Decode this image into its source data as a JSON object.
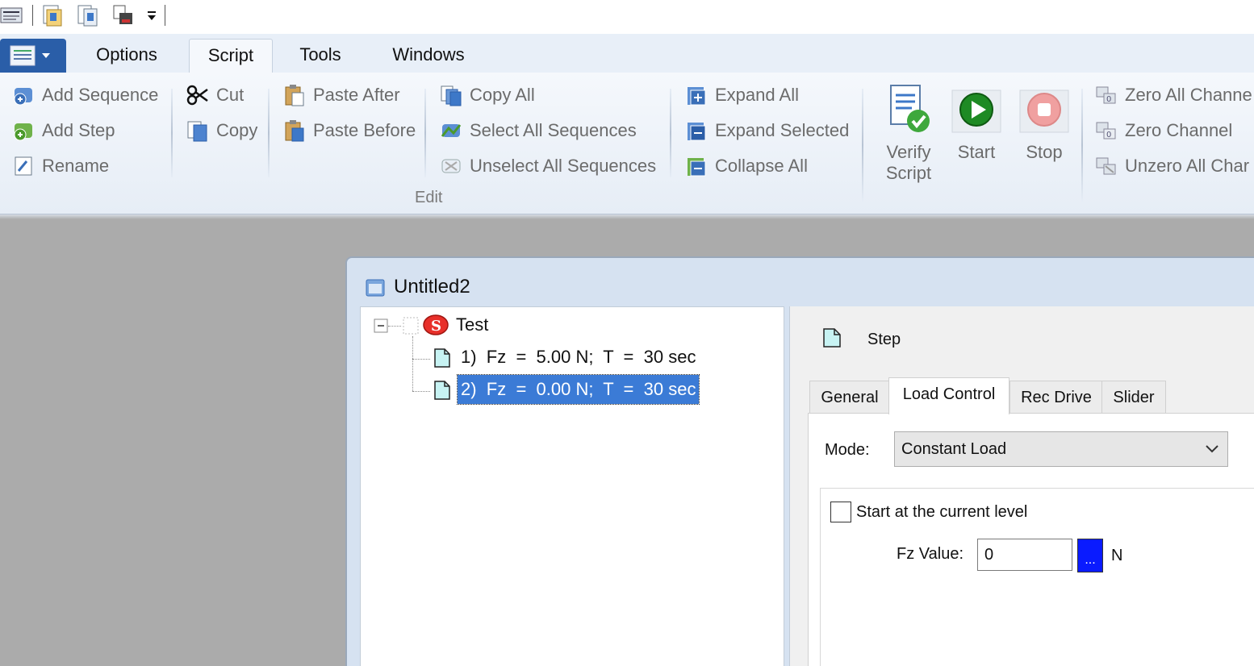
{
  "quick_access": {
    "icons": [
      "app-logo-icon",
      "open-script-icon",
      "save-script-icon",
      "print-icon",
      "customize-dropdown-icon"
    ]
  },
  "tabs": [
    {
      "label": "Options",
      "active": false
    },
    {
      "label": "Script",
      "active": true
    },
    {
      "label": "Tools",
      "active": false
    },
    {
      "label": "Windows",
      "active": false
    }
  ],
  "ribbon": {
    "add_sequence": "Add Sequence",
    "add_step": "Add Step",
    "rename": "Rename",
    "cut": "Cut",
    "copy": "Copy",
    "paste_after": "Paste After",
    "paste_before": "Paste Before",
    "copy_all": "Copy All",
    "select_all_sequences": "Select All Sequences",
    "unselect_all_sequences": "Unselect All Sequences",
    "expand_all": "Expand All",
    "expand_selected": "Expand Selected",
    "collapse_all": "Collapse All",
    "group_edit": "Edit",
    "verify_line1": "Verify",
    "verify_line2": "Script",
    "start": "Start",
    "stop": "Stop",
    "zero_all_channels": "Zero All Channe",
    "zero_channel": "Zero Channel",
    "unzero_all_channels": "Unzero All Char"
  },
  "document": {
    "title": "Untitled2",
    "tree": {
      "root": "Test",
      "items": [
        {
          "index": "1)",
          "text": "Fz  =  5.00 N;  T  =  30 sec",
          "selected": false
        },
        {
          "index": "2)",
          "text": "Fz  =  0.00 N;  T  =  30 sec",
          "selected": true
        }
      ]
    },
    "properties": {
      "header": "Step",
      "tabs": [
        {
          "label": "General",
          "active": false
        },
        {
          "label": "Load Control",
          "active": true
        },
        {
          "label": "Rec Drive",
          "active": false
        },
        {
          "label": "Slider",
          "active": false
        }
      ],
      "mode_label": "Mode:",
      "mode_value": "Constant Load",
      "start_current_label": "Start at the current level",
      "start_current_checked": false,
      "fz_label": "Fz Value:",
      "fz_value": "0",
      "fz_button": "...",
      "fz_unit": "N"
    }
  },
  "colors": {
    "selection": "#3b7bd6",
    "app_menu": "#2a5ea8",
    "value_button": "#0a1bff"
  }
}
